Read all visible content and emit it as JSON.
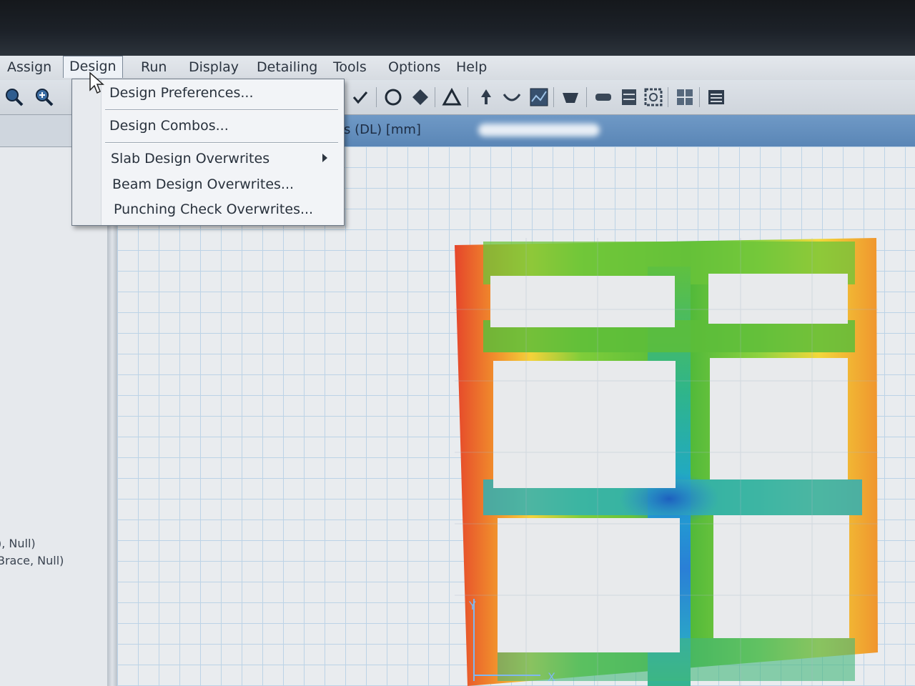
{
  "menubar": {
    "items": [
      {
        "label": "Assign"
      },
      {
        "label": "Design"
      },
      {
        "label": "Run"
      },
      {
        "label": "Display"
      },
      {
        "label": "Detailing"
      },
      {
        "label": "Tools"
      },
      {
        "label": "Options"
      },
      {
        "label": "Help"
      }
    ]
  },
  "design_menu": {
    "items": [
      {
        "label": "Design Preferences..."
      },
      {
        "label": "Design Combos..."
      },
      {
        "label": "Slab Design Overwrites"
      },
      {
        "label": "Beam Design Overwrites..."
      },
      {
        "label": "Punching Check Overwrites..."
      }
    ]
  },
  "view": {
    "title": "ts (DL)  [mm]"
  },
  "left_panel": {
    "lines": [
      "), Null)",
      "Brace, Null)"
    ]
  },
  "axes": {
    "y_label": "Y",
    "x_label": "X"
  },
  "colors": {
    "grid": "#bcd3e6",
    "menu_bg": "#f2f4f7",
    "titlebar": "#5a86b6",
    "contour_high": "#e5452b",
    "contour_low": "#1d5fbf"
  },
  "icons": [
    "zoom-out-icon",
    "zoom-in-icon",
    "check-icon",
    "circle-icon",
    "diamond-icon",
    "triangle-icon",
    "support-icon",
    "spring-icon",
    "mesh-icon",
    "view-icon",
    "slab-icon",
    "table-icon",
    "frame-icon",
    "grid-icon",
    "report-icon"
  ]
}
